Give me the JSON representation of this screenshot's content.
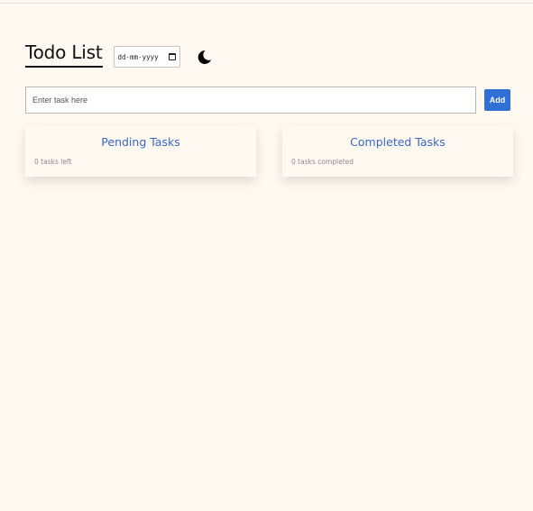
{
  "header": {
    "title": "Todo List",
    "date_placeholder": "dd-mm-yyyy",
    "theme_toggle_icon": "moon-icon"
  },
  "task_form": {
    "input_placeholder": "Enter task here",
    "input_value": "",
    "add_label": "Add"
  },
  "lists": {
    "pending": {
      "title": "Pending Tasks",
      "count_text": "0 tasks left"
    },
    "completed": {
      "title": "Completed Tasks",
      "count_text": "0 tasks completed"
    }
  },
  "colors": {
    "background": "#fff9f1",
    "accent": "#2f6fd6",
    "card_title": "#3a67c7"
  }
}
